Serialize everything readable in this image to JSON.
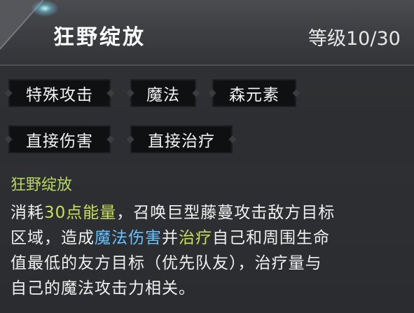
{
  "skill": {
    "name": "狂野绽放",
    "level_text": "等级10/30"
  },
  "tags": [
    {
      "label": "特殊攻击"
    },
    {
      "label": "魔法"
    },
    {
      "label": "森元素"
    },
    {
      "label": "直接伤害"
    },
    {
      "label": "直接治疗"
    }
  ],
  "description": {
    "title": "狂野绽放",
    "line1": {
      "a": "消耗",
      "b": "30点能量",
      "c": "，召唤巨型藤蔓攻击敌方目标"
    },
    "line2": {
      "a": "区域，造成",
      "b": "魔法伤害",
      "c": "并",
      "d": "治疗",
      "e": "自己和周围生命"
    },
    "line3": "值最低的友方目标（优先队友），治疗量与",
    "line4": "自己的魔法攻击力相关。"
  },
  "colors": {
    "highlight_green": "#c6e05a",
    "highlight_blue": "#69c2ff",
    "tag_bg": "#0f1012"
  }
}
